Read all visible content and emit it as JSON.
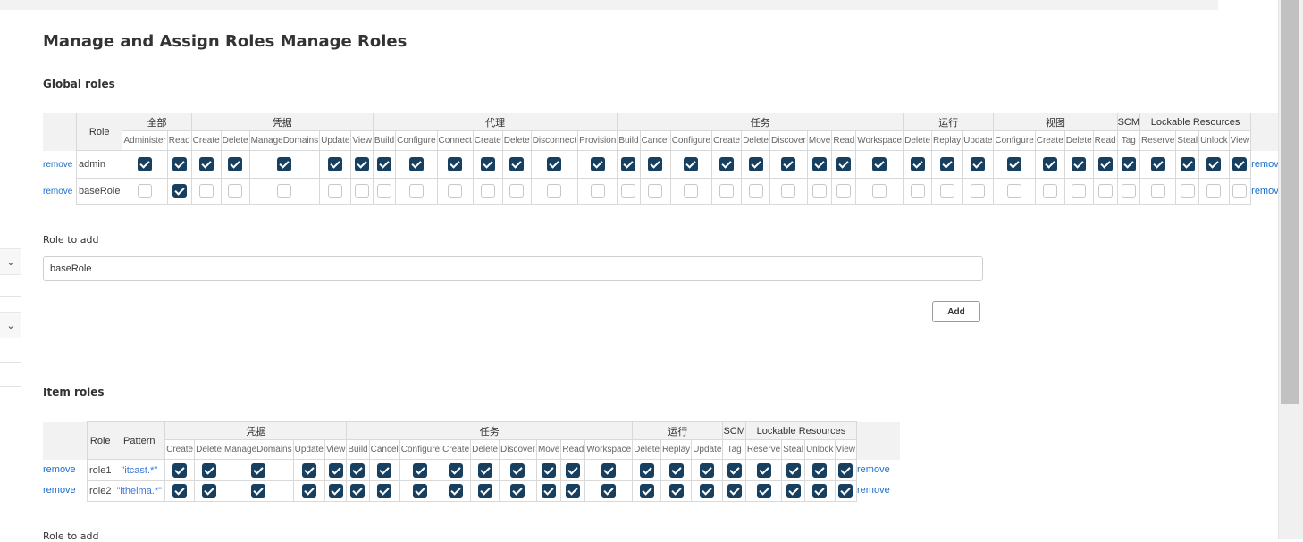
{
  "page": {
    "title_img_alt": "Manage and Assign Roles",
    "title": "Manage Roles"
  },
  "global_roles": {
    "section_title": "Global roles",
    "role_header": "Role",
    "remove_alt": "remove",
    "groups": [
      {
        "name": "全部",
        "perms": [
          "Administer",
          "Read"
        ]
      },
      {
        "name": "凭据",
        "perms": [
          "Create",
          "Delete",
          "ManageDomains",
          "Update",
          "View"
        ]
      },
      {
        "name": "代理",
        "perms": [
          "Build",
          "Configure",
          "Connect",
          "Create",
          "Delete",
          "Disconnect",
          "Provision"
        ]
      },
      {
        "name": "任务",
        "perms": [
          "Build",
          "Cancel",
          "Configure",
          "Create",
          "Delete",
          "Discover",
          "Move",
          "Read",
          "Workspace"
        ]
      },
      {
        "name": "运行",
        "perms": [
          "Delete",
          "Replay",
          "Update"
        ]
      },
      {
        "name": "视图",
        "perms": [
          "Configure",
          "Create",
          "Delete",
          "Read"
        ]
      },
      {
        "name": "SCM",
        "perms": [
          "Tag"
        ]
      },
      {
        "name": "Lockable Resources",
        "perms": [
          "Reserve",
          "Steal",
          "Unlock",
          "View"
        ]
      }
    ],
    "rows": [
      {
        "name": "admin",
        "checks": [
          1,
          1,
          1,
          1,
          1,
          1,
          1,
          1,
          1,
          1,
          1,
          1,
          1,
          1,
          1,
          1,
          1,
          1,
          1,
          1,
          1,
          1,
          1,
          1,
          1,
          1,
          1,
          1,
          1,
          1,
          1,
          1,
          1,
          1,
          1
        ]
      },
      {
        "name": "baseRole",
        "checks": [
          0,
          1,
          0,
          0,
          0,
          0,
          0,
          0,
          0,
          0,
          0,
          0,
          0,
          0,
          0,
          0,
          0,
          0,
          0,
          0,
          0,
          0,
          0,
          0,
          0,
          0,
          0,
          0,
          0,
          0,
          0,
          0,
          0,
          0,
          0
        ]
      }
    ],
    "role_to_add_label": "Role to add",
    "role_to_add_value": "baseRole",
    "add_button": "Add"
  },
  "item_roles": {
    "section_title": "Item roles",
    "role_header": "Role",
    "pattern_header": "Pattern",
    "remove_alt": "remove",
    "groups": [
      {
        "name": "凭据",
        "perms": [
          "Create",
          "Delete",
          "ManageDomains",
          "Update",
          "View"
        ]
      },
      {
        "name": "任务",
        "perms": [
          "Build",
          "Cancel",
          "Configure",
          "Create",
          "Delete",
          "Discover",
          "Move",
          "Read",
          "Workspace"
        ]
      },
      {
        "name": "运行",
        "perms": [
          "Delete",
          "Replay",
          "Update"
        ]
      },
      {
        "name": "SCM",
        "perms": [
          "Tag"
        ]
      },
      {
        "name": "Lockable Resources",
        "perms": [
          "Reserve",
          "Steal",
          "Unlock",
          "View"
        ]
      }
    ],
    "rows": [
      {
        "name": "role1",
        "pattern": "\"itcast.*\"",
        "checks": [
          1,
          1,
          1,
          1,
          1,
          1,
          1,
          1,
          1,
          1,
          1,
          1,
          1,
          1,
          1,
          1,
          1,
          1,
          1,
          1,
          1,
          1
        ]
      },
      {
        "name": "role2",
        "pattern": "\"itheima.*\"",
        "checks": [
          1,
          1,
          1,
          1,
          1,
          1,
          1,
          1,
          1,
          1,
          1,
          1,
          1,
          1,
          1,
          1,
          1,
          1,
          1,
          1,
          1,
          1
        ]
      }
    ],
    "role_to_add_label": "Role to add"
  },
  "sidebar": {
    "chevron_icon": "chevron-down-icon"
  },
  "colors": {
    "checkbox_checked": "#173f5f",
    "link": "#1a6fc9"
  }
}
